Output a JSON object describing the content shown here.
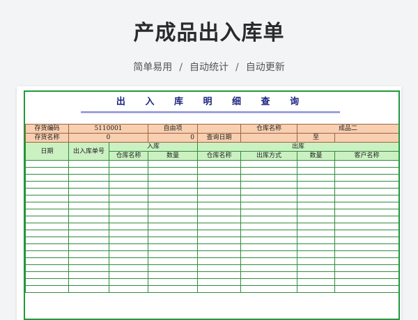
{
  "page": {
    "title": "产成品出入库单",
    "breadcrumb": [
      "简单易用",
      "自动统计",
      "自动更新"
    ],
    "breadcrumb_sep": "/"
  },
  "sheet": {
    "title": "出 入 库 明 细 查 询",
    "info_row1": {
      "label1": "存货编码",
      "value1": "5110001",
      "label2": "自由项",
      "value2": "",
      "label3": "仓库名称",
      "value3": "成品二"
    },
    "info_row2": {
      "label1": "存货名称",
      "value1": "0",
      "value2": "0",
      "label3": "查询日期",
      "value3": "",
      "label4": "至",
      "value4": ""
    },
    "header": {
      "date": "日期",
      "doc_no": "出入库单号",
      "in_group": "入库",
      "out_group": "出库",
      "in_warehouse": "仓库名称",
      "in_qty": "数量",
      "out_warehouse": "仓库名称",
      "out_method": "出库方式",
      "out_qty": "数量",
      "customer": "客户名称"
    }
  },
  "colors": {
    "grid_line": "#2e8b3c",
    "sheet_border": "#1f9a3a",
    "header_fill": "#cbf1c2",
    "info_fill": "#f8cfb0",
    "title_color": "#1a237e"
  }
}
